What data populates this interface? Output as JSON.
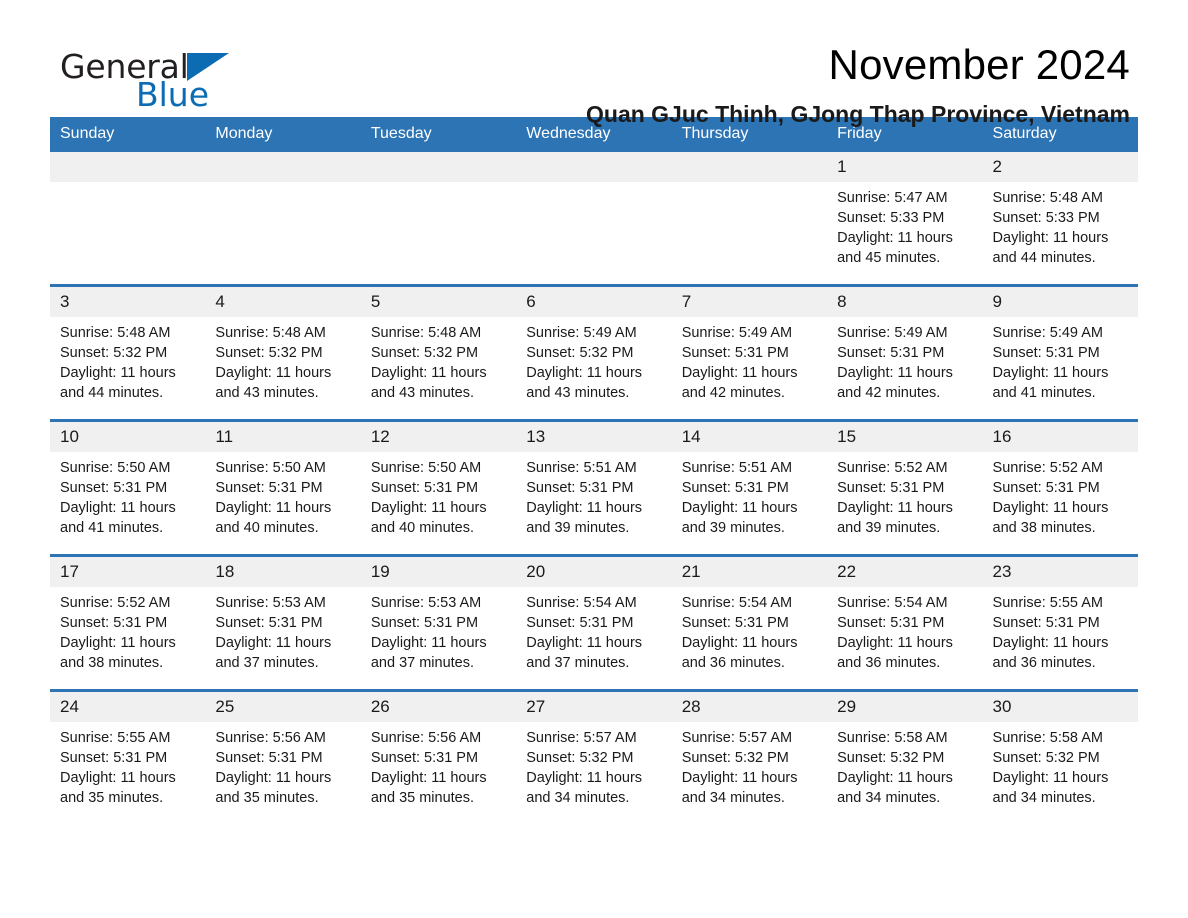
{
  "brand": {
    "word1": "General",
    "word2": "Blue",
    "flag_icon": "triangle-flag-icon",
    "accent_color": "#0b6cb3"
  },
  "header": {
    "month_title": "November 2024",
    "location": "Quan GJuc Thinh, GJong Thap Province, Vietnam"
  },
  "calendar": {
    "header_color": "#2d74b5",
    "daynum_band_color": "#f0f0f0",
    "weekday_headers": [
      "Sunday",
      "Monday",
      "Tuesday",
      "Wednesday",
      "Thursday",
      "Friday",
      "Saturday"
    ],
    "weeks": [
      [
        {
          "day": "",
          "sunrise": "",
          "sunset": "",
          "daylight": "",
          "empty": true
        },
        {
          "day": "",
          "sunrise": "",
          "sunset": "",
          "daylight": "",
          "empty": true
        },
        {
          "day": "",
          "sunrise": "",
          "sunset": "",
          "daylight": "",
          "empty": true
        },
        {
          "day": "",
          "sunrise": "",
          "sunset": "",
          "daylight": "",
          "empty": true
        },
        {
          "day": "",
          "sunrise": "",
          "sunset": "",
          "daylight": "",
          "empty": true
        },
        {
          "day": "1",
          "sunrise": "Sunrise: 5:47 AM",
          "sunset": "Sunset: 5:33 PM",
          "daylight": "Daylight: 11 hours and 45 minutes."
        },
        {
          "day": "2",
          "sunrise": "Sunrise: 5:48 AM",
          "sunset": "Sunset: 5:33 PM",
          "daylight": "Daylight: 11 hours and 44 minutes."
        }
      ],
      [
        {
          "day": "3",
          "sunrise": "Sunrise: 5:48 AM",
          "sunset": "Sunset: 5:32 PM",
          "daylight": "Daylight: 11 hours and 44 minutes."
        },
        {
          "day": "4",
          "sunrise": "Sunrise: 5:48 AM",
          "sunset": "Sunset: 5:32 PM",
          "daylight": "Daylight: 11 hours and 43 minutes."
        },
        {
          "day": "5",
          "sunrise": "Sunrise: 5:48 AM",
          "sunset": "Sunset: 5:32 PM",
          "daylight": "Daylight: 11 hours and 43 minutes."
        },
        {
          "day": "6",
          "sunrise": "Sunrise: 5:49 AM",
          "sunset": "Sunset: 5:32 PM",
          "daylight": "Daylight: 11 hours and 43 minutes."
        },
        {
          "day": "7",
          "sunrise": "Sunrise: 5:49 AM",
          "sunset": "Sunset: 5:31 PM",
          "daylight": "Daylight: 11 hours and 42 minutes."
        },
        {
          "day": "8",
          "sunrise": "Sunrise: 5:49 AM",
          "sunset": "Sunset: 5:31 PM",
          "daylight": "Daylight: 11 hours and 42 minutes."
        },
        {
          "day": "9",
          "sunrise": "Sunrise: 5:49 AM",
          "sunset": "Sunset: 5:31 PM",
          "daylight": "Daylight: 11 hours and 41 minutes."
        }
      ],
      [
        {
          "day": "10",
          "sunrise": "Sunrise: 5:50 AM",
          "sunset": "Sunset: 5:31 PM",
          "daylight": "Daylight: 11 hours and 41 minutes."
        },
        {
          "day": "11",
          "sunrise": "Sunrise: 5:50 AM",
          "sunset": "Sunset: 5:31 PM",
          "daylight": "Daylight: 11 hours and 40 minutes."
        },
        {
          "day": "12",
          "sunrise": "Sunrise: 5:50 AM",
          "sunset": "Sunset: 5:31 PM",
          "daylight": "Daylight: 11 hours and 40 minutes."
        },
        {
          "day": "13",
          "sunrise": "Sunrise: 5:51 AM",
          "sunset": "Sunset: 5:31 PM",
          "daylight": "Daylight: 11 hours and 39 minutes."
        },
        {
          "day": "14",
          "sunrise": "Sunrise: 5:51 AM",
          "sunset": "Sunset: 5:31 PM",
          "daylight": "Daylight: 11 hours and 39 minutes."
        },
        {
          "day": "15",
          "sunrise": "Sunrise: 5:52 AM",
          "sunset": "Sunset: 5:31 PM",
          "daylight": "Daylight: 11 hours and 39 minutes."
        },
        {
          "day": "16",
          "sunrise": "Sunrise: 5:52 AM",
          "sunset": "Sunset: 5:31 PM",
          "daylight": "Daylight: 11 hours and 38 minutes."
        }
      ],
      [
        {
          "day": "17",
          "sunrise": "Sunrise: 5:52 AM",
          "sunset": "Sunset: 5:31 PM",
          "daylight": "Daylight: 11 hours and 38 minutes."
        },
        {
          "day": "18",
          "sunrise": "Sunrise: 5:53 AM",
          "sunset": "Sunset: 5:31 PM",
          "daylight": "Daylight: 11 hours and 37 minutes."
        },
        {
          "day": "19",
          "sunrise": "Sunrise: 5:53 AM",
          "sunset": "Sunset: 5:31 PM",
          "daylight": "Daylight: 11 hours and 37 minutes."
        },
        {
          "day": "20",
          "sunrise": "Sunrise: 5:54 AM",
          "sunset": "Sunset: 5:31 PM",
          "daylight": "Daylight: 11 hours and 37 minutes."
        },
        {
          "day": "21",
          "sunrise": "Sunrise: 5:54 AM",
          "sunset": "Sunset: 5:31 PM",
          "daylight": "Daylight: 11 hours and 36 minutes."
        },
        {
          "day": "22",
          "sunrise": "Sunrise: 5:54 AM",
          "sunset": "Sunset: 5:31 PM",
          "daylight": "Daylight: 11 hours and 36 minutes."
        },
        {
          "day": "23",
          "sunrise": "Sunrise: 5:55 AM",
          "sunset": "Sunset: 5:31 PM",
          "daylight": "Daylight: 11 hours and 36 minutes."
        }
      ],
      [
        {
          "day": "24",
          "sunrise": "Sunrise: 5:55 AM",
          "sunset": "Sunset: 5:31 PM",
          "daylight": "Daylight: 11 hours and 35 minutes."
        },
        {
          "day": "25",
          "sunrise": "Sunrise: 5:56 AM",
          "sunset": "Sunset: 5:31 PM",
          "daylight": "Daylight: 11 hours and 35 minutes."
        },
        {
          "day": "26",
          "sunrise": "Sunrise: 5:56 AM",
          "sunset": "Sunset: 5:31 PM",
          "daylight": "Daylight: 11 hours and 35 minutes."
        },
        {
          "day": "27",
          "sunrise": "Sunrise: 5:57 AM",
          "sunset": "Sunset: 5:32 PM",
          "daylight": "Daylight: 11 hours and 34 minutes."
        },
        {
          "day": "28",
          "sunrise": "Sunrise: 5:57 AM",
          "sunset": "Sunset: 5:32 PM",
          "daylight": "Daylight: 11 hours and 34 minutes."
        },
        {
          "day": "29",
          "sunrise": "Sunrise: 5:58 AM",
          "sunset": "Sunset: 5:32 PM",
          "daylight": "Daylight: 11 hours and 34 minutes."
        },
        {
          "day": "30",
          "sunrise": "Sunrise: 5:58 AM",
          "sunset": "Sunset: 5:32 PM",
          "daylight": "Daylight: 11 hours and 34 minutes."
        }
      ]
    ]
  }
}
